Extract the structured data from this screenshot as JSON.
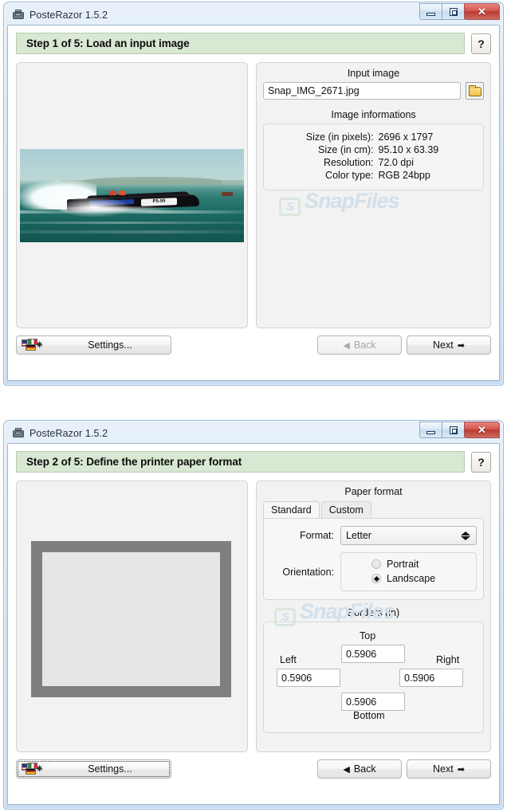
{
  "window1": {
    "title": "PosteRazor 1.5.2",
    "app_icon": "printer-icon",
    "controls": {
      "minimize": "minimize-icon",
      "restore": "restore-icon",
      "close": "close-icon"
    },
    "step_header": "Step 1 of 5: Load an input image",
    "help_label": "?",
    "input_image": {
      "group_label": "Input image",
      "filename": "Snap_IMG_2671.jpg",
      "browse_icon": "folder-open-icon"
    },
    "image_information": {
      "group_label": "Image informations",
      "rows": [
        {
          "key": "Size (in pixels):",
          "value": "2696 x 1797"
        },
        {
          "key": "Size (in cm):",
          "value": "95.10 x 63.39"
        },
        {
          "key": "Resolution:",
          "value": "72.0 dpi"
        },
        {
          "key": "Color type:",
          "value": "RGB 24bpp"
        }
      ]
    },
    "watermark": "SnapFiles",
    "footer": {
      "settings_label": "Settings...",
      "back_label": "Back",
      "next_label": "Next",
      "back_enabled": false
    }
  },
  "window2": {
    "title": "PosteRazor 1.5.2",
    "step_header": "Step 2 of 5: Define the printer paper format",
    "help_label": "?",
    "paper_format": {
      "group_label": "Paper format",
      "tabs": [
        {
          "label": "Standard",
          "active": true
        },
        {
          "label": "Custom",
          "active": false
        }
      ],
      "format_label": "Format:",
      "format_value": "Letter",
      "orientation_label": "Orientation:",
      "orientation_options": [
        {
          "label": "Portrait",
          "selected": false
        },
        {
          "label": "Landscape",
          "selected": true
        }
      ]
    },
    "borders": {
      "group_label": "Borders (in)",
      "top_label": "Top",
      "top_value": "0.5906",
      "left_label": "Left",
      "left_value": "0.5906",
      "right_label": "Right",
      "right_value": "0.5906",
      "bottom_label": "Bottom",
      "bottom_value": "0.5906"
    },
    "watermark": "SnapFiles",
    "footer": {
      "settings_label": "Settings...",
      "back_label": "Back",
      "next_label": "Next",
      "back_enabled": true
    }
  },
  "colors": {
    "step_header_bg": "#d9e8d2",
    "title_bar": "#cfe1f3",
    "close_button": "#c0392b",
    "paper_sheet": "#7f7f7f",
    "watermark": "#d2e0ea"
  }
}
